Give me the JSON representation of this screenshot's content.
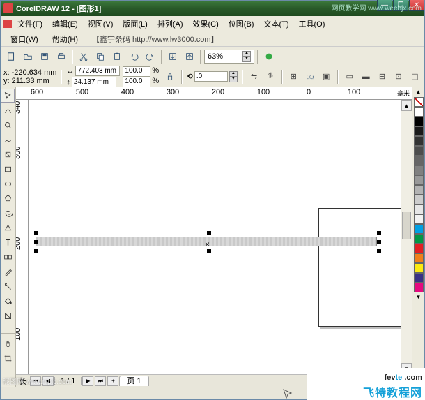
{
  "title": "CorelDRAW 12 - [图形1]",
  "watermark_top": "网页教学网\nwww.weebjx.com",
  "menu": {
    "file": "文件(F)",
    "edit": "编辑(E)",
    "view": "视图(V)",
    "layout": "版面(L)",
    "arrange": "排列(A)",
    "effects": "效果(C)",
    "bitmap": "位图(B)",
    "text": "文本(T)",
    "tools": "工具(O)",
    "window": "窗口(W)",
    "help": "帮助(H)",
    "extra": "【鑫宇条码 http://www.lw3000.com】"
  },
  "toolbar": {
    "zoom": "63%"
  },
  "coords": {
    "x": "x: -220.634 mm",
    "y": "y: 211.33 mm",
    "w": "772.403 mm",
    "h": "24.137 mm",
    "sx": "100.0",
    "sy": "100.0",
    "rot": ".0"
  },
  "ruler": {
    "h": [
      "600",
      "500",
      "400",
      "300",
      "200",
      "100",
      "0",
      "100"
    ],
    "v": [
      "340",
      "300",
      "200",
      "100"
    ],
    "unit": "毫米"
  },
  "pages": {
    "count": "1 / 1",
    "tab": "页 1",
    "info": "长"
  },
  "palette": [
    "none",
    "#ffffff",
    "#000000",
    "#1a1a1a",
    "#333333",
    "#4d4d4d",
    "#666666",
    "#808080",
    "#999999",
    "#b3b3b3",
    "#cccccc",
    "#e6e6e6",
    "#f2f2f2",
    "#00a0e3",
    "#009846",
    "#e31e24",
    "#ef7f1a",
    "#fcea10",
    "#393185",
    "#e5097f"
  ],
  "brand": {
    "l1_a": "fev",
    "l1_b": "te",
    "l1_c": " .com",
    "l2": "飞特教程网"
  },
  "wm_bottom": "昵图网 www.nipic.com",
  "icons": {
    "new": "new-icon",
    "open": "open-icon",
    "save": "save-icon",
    "print": "print-icon",
    "cut": "cut-icon",
    "copy": "copy-icon",
    "paste": "paste-icon",
    "undo": "undo-icon",
    "redo": "redo-icon",
    "import": "import-icon",
    "export": "export-icon"
  }
}
